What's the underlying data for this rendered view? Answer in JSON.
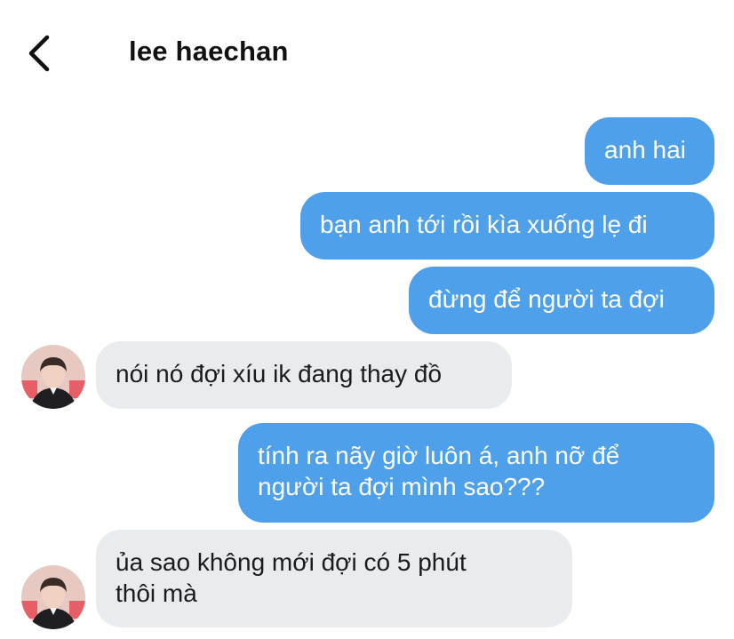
{
  "header": {
    "title": "lee haechan"
  },
  "messages": [
    {
      "direction": "outgoing",
      "text": "anh hai"
    },
    {
      "direction": "outgoing",
      "text": "bạn anh tới rồi kìa xuống lẹ đi"
    },
    {
      "direction": "outgoing",
      "text": "đừng để người ta đợi"
    },
    {
      "direction": "incoming",
      "text": "nói nó đợi xíu ik đang thay đồ"
    },
    {
      "direction": "outgoing",
      "text": "tính ra nãy giờ luôn á, anh nỡ để\nngười ta đợi mình sao???"
    },
    {
      "direction": "incoming",
      "text": "ủa sao không mới đợi có 5 phút\nthôi mà"
    }
  ],
  "colors": {
    "outgoing_bubble": "#4ea0eb",
    "incoming_bubble": "#e9ecef",
    "background": "#ffffff"
  },
  "icons": {
    "back": "chevron-left-icon",
    "avatar": "contact-avatar"
  }
}
